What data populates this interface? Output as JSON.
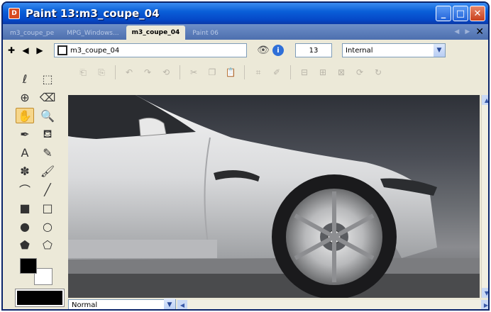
{
  "window": {
    "title": "Paint 13:m3_coupe_04",
    "app_icon_text": "D"
  },
  "tabs": [
    {
      "label": "m3_coupe_pe"
    },
    {
      "label": "MPG_Windows..."
    },
    {
      "label": "m3_coupe_04",
      "active": true
    },
    {
      "label": "Paint 06"
    }
  ],
  "toolbar": {
    "document_name": "m3_coupe_04",
    "zoom_value": "13",
    "store_select": "Internal"
  },
  "statusbar": {
    "blend_mode": "Normal"
  },
  "colors": {
    "foreground": "#000000",
    "background": "#ffffff",
    "accent": "#0a5fd8"
  },
  "tools": [
    {
      "name": "lasso-icon",
      "glyph": "ℓ"
    },
    {
      "name": "marquee-icon",
      "glyph": "⬚"
    },
    {
      "name": "move-icon",
      "glyph": "⊕"
    },
    {
      "name": "eraser-icon",
      "glyph": "⌫"
    },
    {
      "name": "hand-icon",
      "glyph": "✋",
      "selected": true
    },
    {
      "name": "zoom-icon",
      "glyph": "🔍"
    },
    {
      "name": "eyedropper-icon",
      "glyph": "✒"
    },
    {
      "name": "fill-icon",
      "glyph": "⛾"
    },
    {
      "name": "text-icon",
      "glyph": "A"
    },
    {
      "name": "pencil-icon",
      "glyph": "✎"
    },
    {
      "name": "spray-icon",
      "glyph": "✽"
    },
    {
      "name": "brush-icon",
      "glyph": "🖌"
    },
    {
      "name": "curve-icon",
      "glyph": "⌒"
    },
    {
      "name": "line-icon",
      "glyph": "╱"
    },
    {
      "name": "filled-rect-icon",
      "glyph": "■"
    },
    {
      "name": "rect-icon",
      "glyph": "□"
    },
    {
      "name": "filled-ellipse-icon",
      "glyph": "●"
    },
    {
      "name": "ellipse-icon",
      "glyph": "○"
    },
    {
      "name": "filled-polygon-icon",
      "glyph": "⬟"
    },
    {
      "name": "polygon-icon",
      "glyph": "⬠"
    }
  ],
  "action_icons": [
    {
      "name": "new-icon",
      "glyph": "⎗"
    },
    {
      "name": "open-icon",
      "glyph": "⎘"
    },
    {
      "name": "sep1"
    },
    {
      "name": "undo-icon",
      "glyph": "↶"
    },
    {
      "name": "redo-icon",
      "glyph": "↷"
    },
    {
      "name": "revert-icon",
      "glyph": "⟲"
    },
    {
      "name": "sep2"
    },
    {
      "name": "cut-icon",
      "glyph": "✂"
    },
    {
      "name": "copy-icon",
      "glyph": "❐"
    },
    {
      "name": "paste-icon",
      "glyph": "📋"
    },
    {
      "name": "sep3"
    },
    {
      "name": "crop-icon",
      "glyph": "⌗"
    },
    {
      "name": "edit-icon",
      "glyph": "✐"
    },
    {
      "name": "sep4"
    },
    {
      "name": "align-left-icon",
      "glyph": "⊟"
    },
    {
      "name": "align-center-icon",
      "glyph": "⊞"
    },
    {
      "name": "align-right-icon",
      "glyph": "⊠"
    },
    {
      "name": "flip-icon",
      "glyph": "⟳"
    },
    {
      "name": "rotate-icon",
      "glyph": "↻"
    }
  ]
}
